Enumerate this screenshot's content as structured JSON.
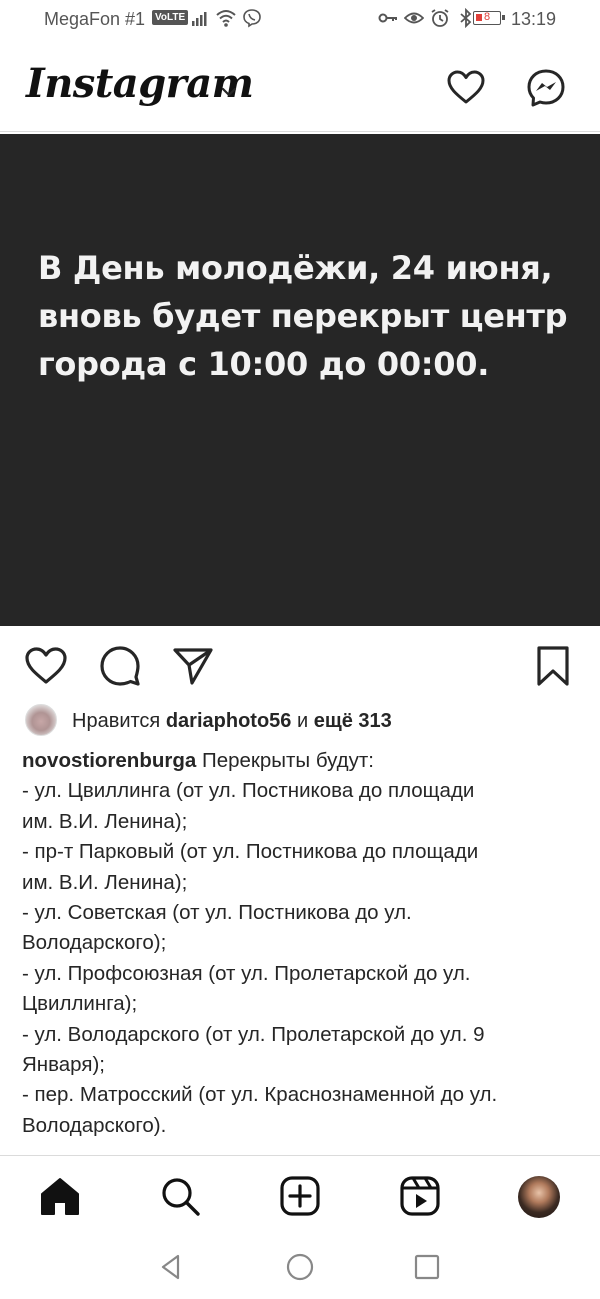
{
  "status_bar": {
    "carrier": "MegaFon #1",
    "volte": "VoLTE",
    "battery": "8",
    "time": "13:19",
    "icons_left": [
      "signal-icon",
      "wifi-icon",
      "viber-icon"
    ],
    "icons_right": [
      "key-icon",
      "eye-icon",
      "alarm-icon",
      "bluetooth-icon",
      "battery-icon"
    ]
  },
  "header": {
    "logo": "Instagram",
    "icons": [
      "chevron-down-icon",
      "heart-icon",
      "messenger-icon"
    ]
  },
  "post": {
    "image_text": "В День молодёжи, 24 июня, вновь будет перекрыт центр города с 10:00 до 00:00.",
    "image_bg": "#262626",
    "actions": [
      "heart-icon",
      "comment-icon",
      "share-icon",
      "bookmark-icon"
    ],
    "likes": {
      "prefix": "Нравится",
      "user": "dariaphoto56",
      "middle": "и",
      "count": "ещё 313"
    },
    "caption": {
      "username": "novostiorenburga",
      "first_line": " Перекрыты будут:",
      "lines": [
        "- ул. Цвиллинга (от ул. Постникова до площади",
        "им. В.И. Ленина);",
        "- пр-т Парковый (от ул. Постникова до площади",
        "им. В.И. Ленина);",
        "- ул. Советская (от ул. Постникова до ул.",
        "Володарского);",
        "- ул. Профсоюзная (от ул. Пролетарской до ул.",
        "Цвиллинга);",
        "- ул. Володарского (от ул. Пролетарской до ул. 9",
        "Января);",
        "- пер. Матросский (от ул. Краснознаменной до ул.",
        "Володарского)."
      ]
    }
  },
  "bottom_nav": [
    "home-icon",
    "search-icon",
    "new-post-icon",
    "reels-icon",
    "profile-avatar"
  ],
  "system_nav": [
    "back-icon",
    "home-circle-icon",
    "recents-icon"
  ]
}
